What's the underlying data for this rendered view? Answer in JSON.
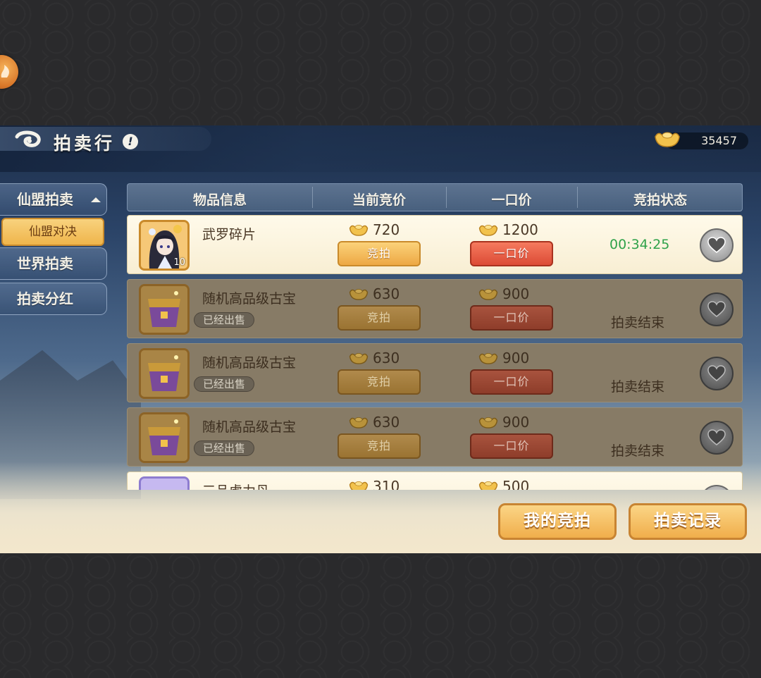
{
  "header": {
    "title": "拍卖行",
    "help_glyph": "!",
    "currency_amount": "35457",
    "currency_icon": "gold-ingot-icon"
  },
  "nav": {
    "items": [
      {
        "label": "仙盟拍卖",
        "expanded": true
      },
      {
        "label": "世界拍卖"
      },
      {
        "label": "拍卖分红"
      }
    ],
    "sub_items": [
      {
        "label": "仙盟对决",
        "selected": true
      }
    ]
  },
  "table": {
    "columns": [
      "物品信息",
      "当前竞价",
      "一口价",
      "竞拍状态"
    ],
    "rows": [
      {
        "name": "武罗碎片",
        "thumb_count": "10",
        "current_bid": "720",
        "buyout": "1200",
        "bid_label": "竞拍",
        "buyout_label": "一口价",
        "status": "00:34:25",
        "state": "active",
        "sold_label": ""
      },
      {
        "name": "随机高品级古宝",
        "current_bid": "630",
        "buyout": "900",
        "bid_label": "竞拍",
        "buyout_label": "一口价",
        "status": "拍卖结束",
        "state": "ended",
        "sold_label": "已经出售"
      },
      {
        "name": "随机高品级古宝",
        "current_bid": "630",
        "buyout": "900",
        "bid_label": "竞拍",
        "buyout_label": "一口价",
        "status": "拍卖结束",
        "state": "ended",
        "sold_label": "已经出售"
      },
      {
        "name": "随机高品级古宝",
        "current_bid": "630",
        "buyout": "900",
        "bid_label": "竞拍",
        "buyout_label": "一口价",
        "status": "拍卖结束",
        "state": "ended",
        "sold_label": "已经出售"
      },
      {
        "name": "三品虚力丹",
        "current_bid": "310",
        "buyout": "500",
        "state": "active"
      }
    ]
  },
  "footer": {
    "my_bids_label": "我的竞拍",
    "records_label": "拍卖记录"
  },
  "colors": {
    "accent_gold": "#f0ae4b",
    "buyout_red": "#dc4b36",
    "timer_green": "#2fa24a"
  }
}
